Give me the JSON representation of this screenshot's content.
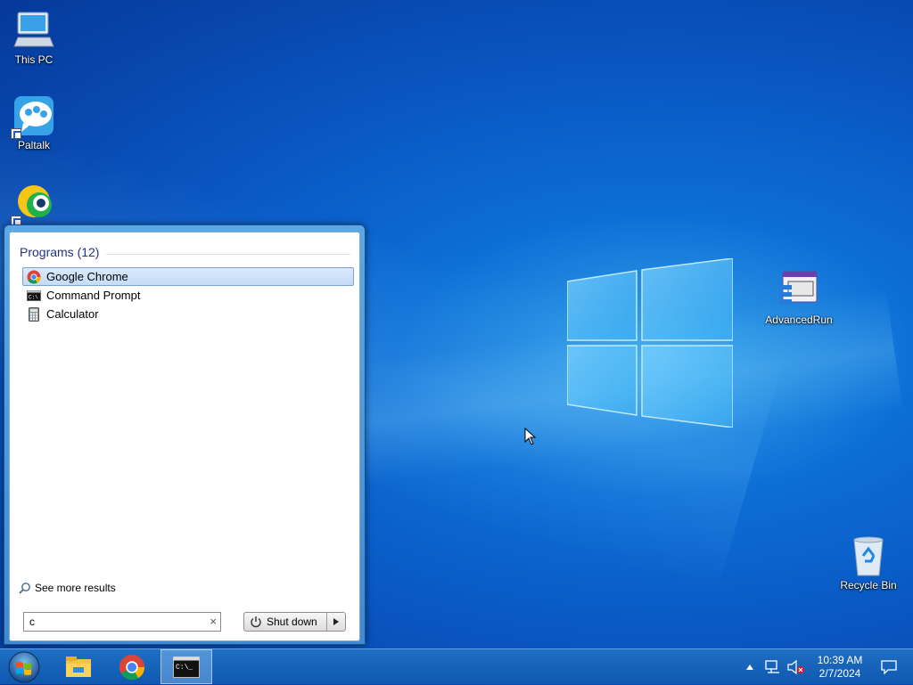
{
  "desktop": {
    "icons": [
      {
        "label": "This PC"
      },
      {
        "label": "Paltalk"
      },
      {
        "label": "AdvancedRun"
      },
      {
        "label": "Recycle Bin"
      }
    ]
  },
  "start_menu": {
    "programs_header": "Programs (12)",
    "results": [
      {
        "label": "Google Chrome",
        "icon": "chrome-icon",
        "selected": true
      },
      {
        "label": "Command Prompt",
        "icon": "cmd-icon",
        "selected": false
      },
      {
        "label": "Calculator",
        "icon": "calculator-icon",
        "selected": false
      }
    ],
    "see_more": "See more results",
    "search_value": "c",
    "search_clear": "×",
    "shutdown_label": "Shut down"
  },
  "taskbar": {
    "pinned": [
      {
        "icon": "file-explorer-icon"
      },
      {
        "icon": "chrome-icon"
      },
      {
        "icon": "cmd-icon",
        "active": true
      }
    ],
    "clock": {
      "time": "10:39 AM",
      "date": "2/7/2024"
    }
  },
  "colors": {
    "accent": "#0a58c4",
    "selection": "#c4dcf6",
    "taskbar": "#1058b0"
  }
}
